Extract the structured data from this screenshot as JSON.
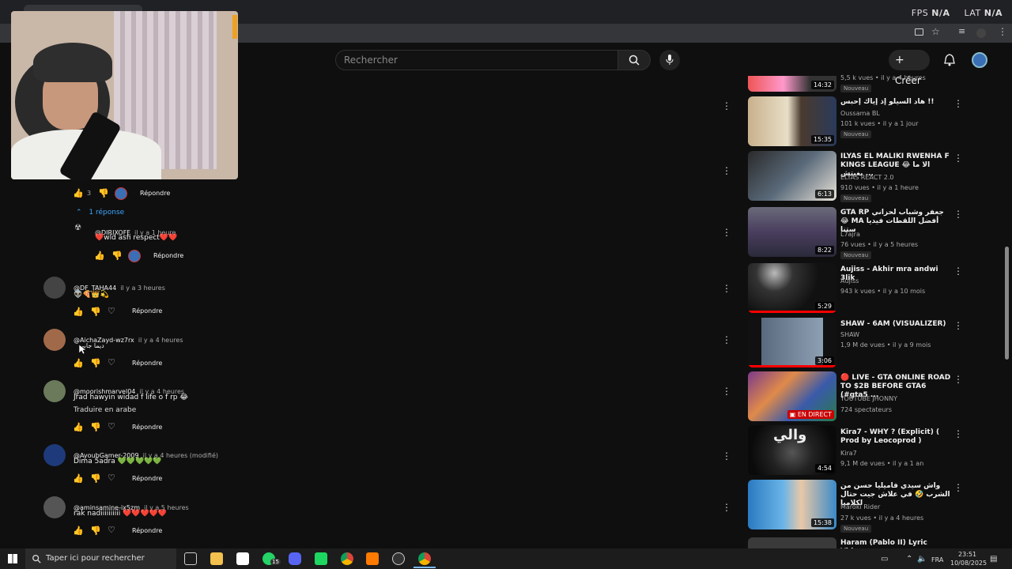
{
  "overlay": {
    "fps": "FPS",
    "fps_value": "N/A",
    "lat": "LAT",
    "lat_value": "N/A"
  },
  "header": {
    "search_placeholder": "Rechercher",
    "create_label": "Créer"
  },
  "comments": [
    {
      "likes": "3",
      "reply_label": "Répondre"
    },
    {
      "replies_toggle": "1 réponse"
    },
    {
      "user": "@DIRIXOFF",
      "time": "il y a 1 heure",
      "text": "❤️wld asfi respect❤️❤️",
      "reply_label": "Répondre"
    },
    {
      "user": "@DF_TAHA44",
      "time": "il y a 3 heures",
      "text": "👽🍕👑💫",
      "reply_label": "Répondre"
    },
    {
      "user": "@AichaZayd-wz7rx",
      "time": "il y a 4 heures",
      "text": "ديما جابي",
      "reply_label": "Répondre"
    },
    {
      "user": "@moorishmarvel04",
      "time": "il y a 4 heures",
      "text": "Jrad hawyin widad f life o f rp 😂",
      "translate": "Traduire en arabe",
      "reply_label": "Répondre"
    },
    {
      "user": "@AyoubGamer-2009",
      "time": "il y a 4 heures (modifié)",
      "text": "Dima 5adra 💚💚💚💚💚",
      "reply_label": "Répondre"
    },
    {
      "user": "@aminsamine-ix5zm",
      "time": "il y a 5 heures",
      "text": "rak nadiiiiiiiiii ❤️❤️❤️❤️❤️",
      "reply_label": "Répondre"
    }
  ],
  "videos": [
    {
      "duration": "14:32",
      "meta": "5,5 k vues • il y a 4 heures",
      "badge": "Nouveau"
    },
    {
      "title": "هاد السيلو إذ إياك إحبس !!",
      "channel": "Oussama BL",
      "meta": "101 k vues • il y a 1 jour",
      "badge": "Nouveau",
      "duration": "15:35"
    },
    {
      "title": "ILYAS EL MALIKI RWENHA F KINGS LEAGUE 😂 الا ما بغيتش ...",
      "channel": "ELYAS REACT 2.0",
      "meta": "910 vues • il y a 1 heure",
      "badge": "Nouveau",
      "duration": "6:13"
    },
    {
      "title": "GTA RP جعفر وشباب لحزاني 😂 MA أفضل اللقطات فيديا ستنا",
      "channel": "L7ajra",
      "meta": "76 vues • il y a 5 heures",
      "badge": "Nouveau",
      "duration": "8:22"
    },
    {
      "title": "Aujiss - Akhir mra andwi 3lik",
      "channel": "Aujiss",
      "meta": "943 k vues • il y a 10 mois",
      "duration": "5:29"
    },
    {
      "title": "SHAW - 6AM (VISUALIZER)",
      "channel": "SHAW",
      "meta": "1,9 M de vues • il y a 9 mois",
      "duration": "3:06"
    },
    {
      "title": "🔴 LIVE - GTA ONLINE ROAD TO $2B BEFORE GTA6 (#gta5 ...",
      "channel": "YOUTUBE JHONNY",
      "meta": "724 spectateurs",
      "live": "EN DIRECT"
    },
    {
      "title": "Kira7 - WHY ? (Explicit) ( Prod by Leocoprod )",
      "channel": "Kira7",
      "meta": "9,1 M de vues • il y a 1 an",
      "duration": "4:54"
    },
    {
      "title": "واش سيدي فاميليا حسن من الشرب 🤣 في علاش جيت حتال لكلاميا",
      "channel": "Maroki Rider",
      "meta": "27 k vues • il y a 4 heures",
      "badge": "Nouveau",
      "duration": "15:38"
    },
    {
      "title": "Haram (Pablo II) Lyric Video"
    }
  ],
  "taskbar": {
    "search_placeholder": "Taper ici pour rechercher",
    "lang": "FRA",
    "time": "23:51",
    "date": "10/08/2025",
    "badge_count": "15"
  },
  "colors": {
    "background": "#0f0f0f",
    "accent_red": "#ff0000",
    "like_green": "#2ecc40"
  }
}
